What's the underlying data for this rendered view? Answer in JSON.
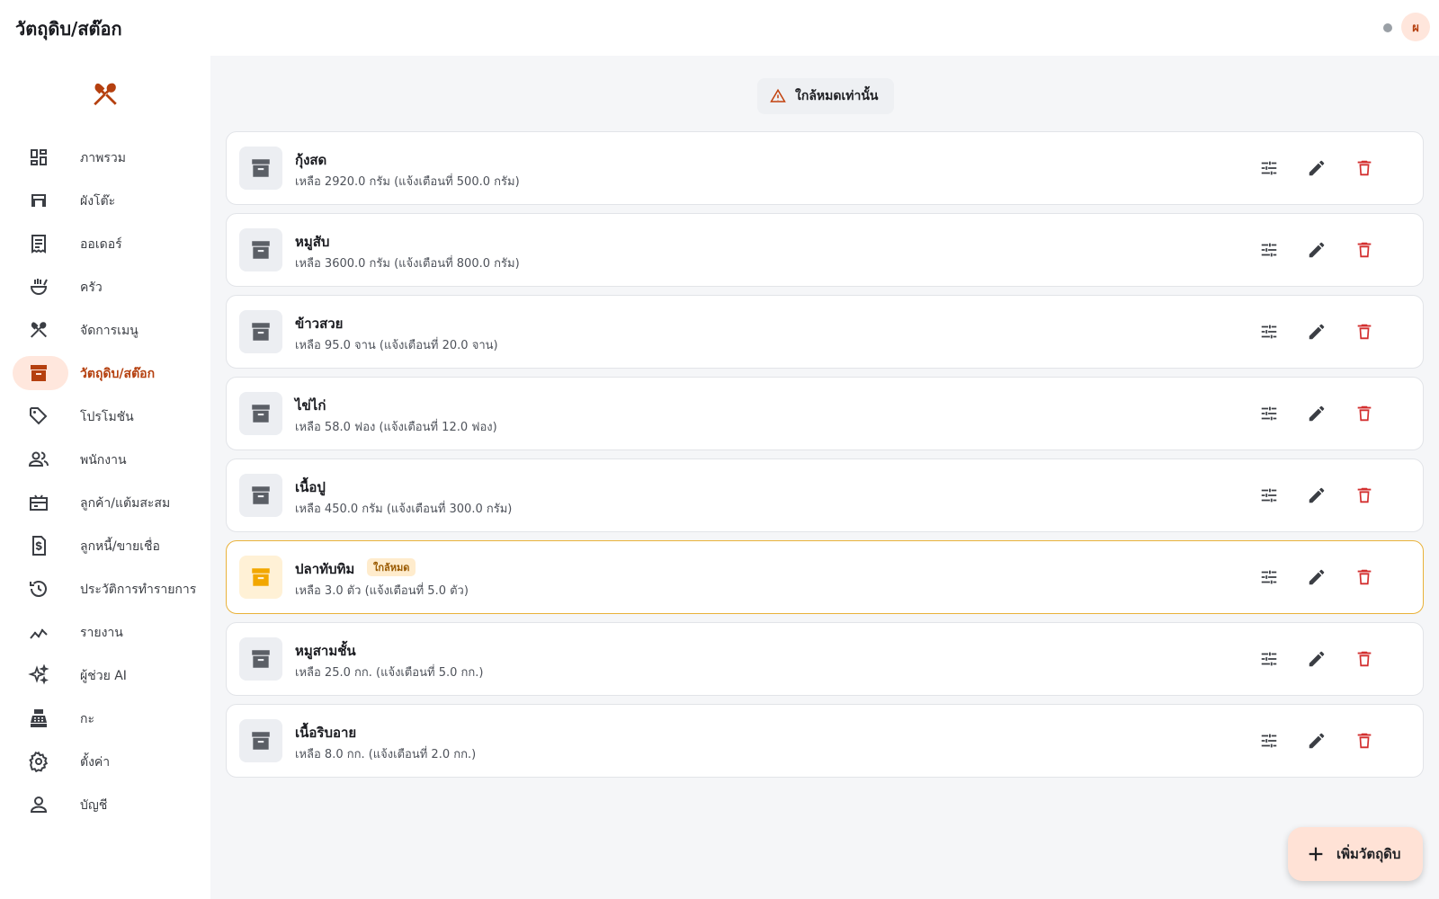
{
  "header": {
    "title": "วัตถุดิบ/สต๊อก",
    "avatar_initial": "ผ"
  },
  "colors": {
    "accent": "#b5400f",
    "accent_soft": "#ffe7dd",
    "warning": "#e9b23a",
    "danger": "#d32f2f",
    "icon_gray": "#5b5f66"
  },
  "sidebar": {
    "logo": "fork-spoon-icon",
    "items": [
      {
        "label": "ภาพรวม",
        "icon": "dashboard-icon",
        "active": false
      },
      {
        "label": "ผังโต๊ะ",
        "icon": "table-icon",
        "active": false
      },
      {
        "label": "ออเดอร์",
        "icon": "receipt-icon",
        "active": false
      },
      {
        "label": "ครัว",
        "icon": "soup-kitchen-icon",
        "active": false
      },
      {
        "label": "จัดการเมนู",
        "icon": "utensils-icon",
        "active": false
      },
      {
        "label": "วัตถุดิบ/สต๊อก",
        "icon": "inventory-box-icon",
        "active": true
      },
      {
        "label": "โปรโมชัน",
        "icon": "tag-icon",
        "active": false
      },
      {
        "label": "พนักงาน",
        "icon": "people-icon",
        "active": false
      },
      {
        "label": "ลูกค้า/แต้มสะสม",
        "icon": "loyalty-card-icon",
        "active": false
      },
      {
        "label": "ลูกหนี้/ขายเชื่อ",
        "icon": "invoice-dollar-icon",
        "active": false
      },
      {
        "label": "ประวัติการทำรายการ",
        "icon": "history-icon",
        "active": false
      },
      {
        "label": "รายงาน",
        "icon": "trend-chart-icon",
        "active": false
      },
      {
        "label": "ผู้ช่วย AI",
        "icon": "sparkle-icon",
        "active": false
      },
      {
        "label": "กะ",
        "icon": "cash-register-icon",
        "active": false
      },
      {
        "label": "ตั้งค่า",
        "icon": "gear-icon",
        "active": false
      },
      {
        "label": "บัญชี",
        "icon": "person-icon",
        "active": false
      }
    ]
  },
  "filter": {
    "label": "ใกล้หมดเท่านั้น",
    "icon": "warning-icon"
  },
  "inventory": [
    {
      "name": "กุ้งสด",
      "detail": "เหลือ 2920.0 กรัม (แจ้งเตือนที่ 500.0 กรัม)",
      "low": false
    },
    {
      "name": "หมูสับ",
      "detail": "เหลือ 3600.0 กรัม (แจ้งเตือนที่ 800.0 กรัม)",
      "low": false
    },
    {
      "name": "ข้าวสวย",
      "detail": "เหลือ 95.0 จาน (แจ้งเตือนที่ 20.0 จาน)",
      "low": false
    },
    {
      "name": "ไข่ไก่",
      "detail": "เหลือ 58.0 ฟอง (แจ้งเตือนที่ 12.0 ฟอง)",
      "low": false
    },
    {
      "name": "เนื้อปู",
      "detail": "เหลือ 450.0 กรัม (แจ้งเตือนที่ 300.0 กรัม)",
      "low": false
    },
    {
      "name": "ปลาทับทิม",
      "detail": "เหลือ 3.0 ตัว (แจ้งเตือนที่ 5.0 ตัว)",
      "low": true,
      "badge": "ใกล้หมด"
    },
    {
      "name": "หมูสามชั้น",
      "detail": "เหลือ 25.0 กก. (แจ้งเตือนที่ 5.0 กก.)",
      "low": false
    },
    {
      "name": "เนื้อริบอาย",
      "detail": "เหลือ 8.0 กก. (แจ้งเตือนที่ 2.0 กก.)",
      "low": false
    }
  ],
  "fab": {
    "label": "เพิ่มวัตถุดิบ",
    "icon": "plus-icon"
  }
}
